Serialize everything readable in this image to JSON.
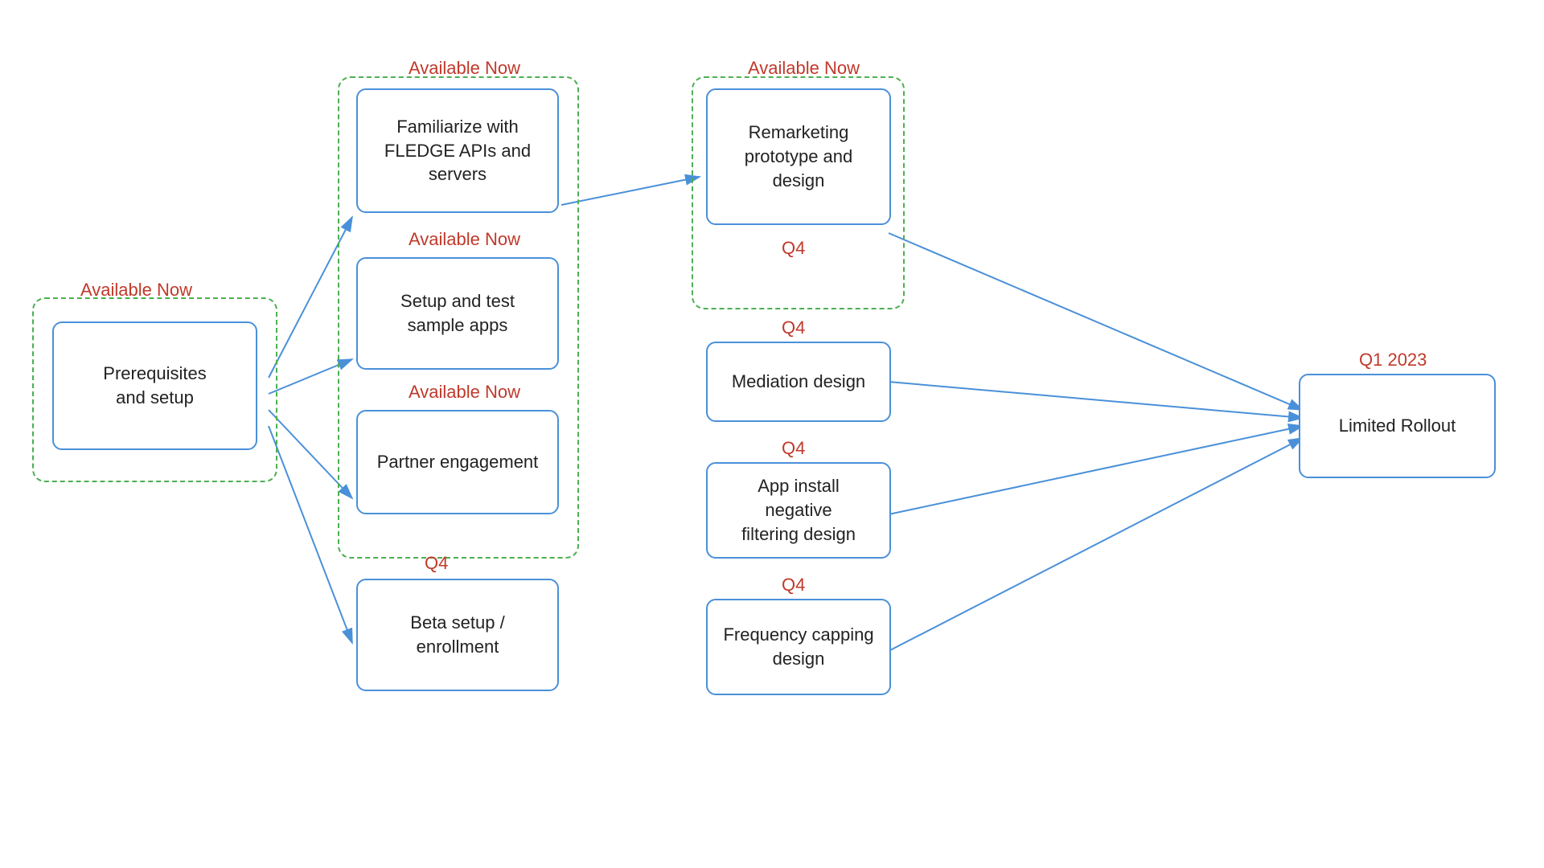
{
  "nodes": {
    "prerequisites": {
      "label": "Prerequisites\nand setup",
      "status": "Available Now"
    },
    "familiarize": {
      "label": "Familiarize with\nFLEDGE APIs and\nservers",
      "status": "Available Now"
    },
    "setup_test": {
      "label": "Setup and test\nsample apps",
      "status": "Available Now"
    },
    "partner": {
      "label": "Partner engagement",
      "status": "Available Now"
    },
    "beta_setup": {
      "label": "Beta setup /\nenrollment",
      "status": "Q4"
    },
    "remarketing": {
      "label": "Remarketing\nprototype and\ndesign",
      "status": "Available Now",
      "sub_status": "Q4"
    },
    "mediation": {
      "label": "Mediation design",
      "status": "Q4"
    },
    "app_install": {
      "label": "App install negative\nfiltering design",
      "status": "Q4"
    },
    "frequency": {
      "label": "Frequency capping\ndesign",
      "status": "Q4"
    },
    "limited_rollout": {
      "label": "Limited Rollout",
      "status": "Q1 2023"
    }
  },
  "labels": {
    "available_now": "Available Now",
    "q4": "Q4",
    "q1_2023": "Q1 2023"
  }
}
